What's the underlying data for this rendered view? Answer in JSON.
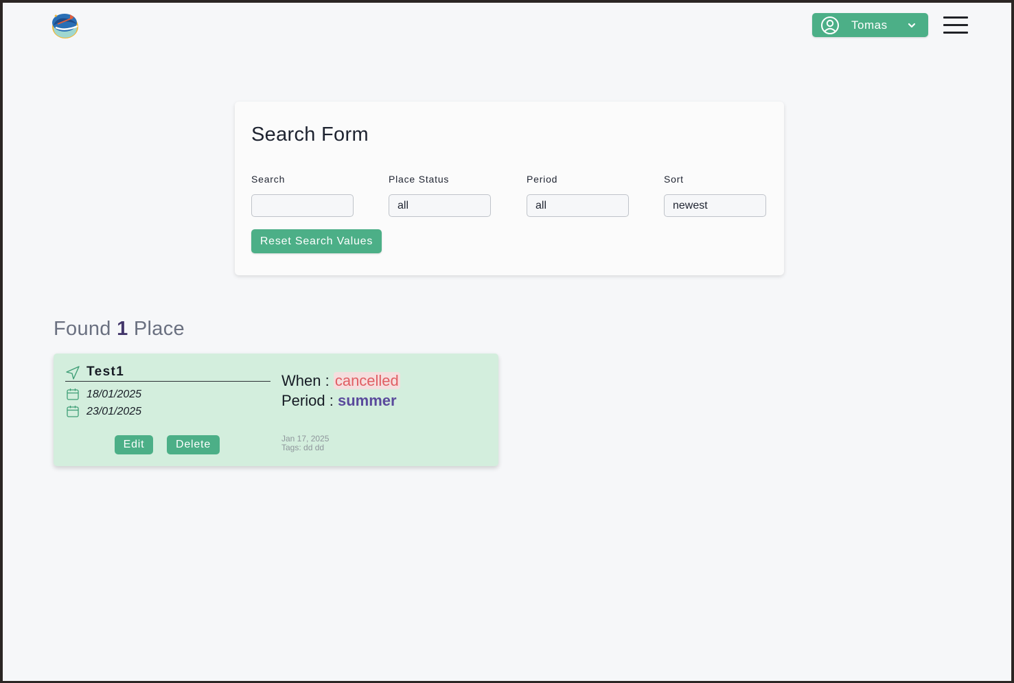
{
  "header": {
    "user_name": "Tomas",
    "icons": {
      "logo": "app-logo",
      "user": "user-circle-icon",
      "dropdown": "chevron-down-icon",
      "menu": "hamburger-menu-icon"
    }
  },
  "search_form": {
    "title": "Search Form",
    "fields": {
      "search": {
        "label": "Search",
        "value": ""
      },
      "place_status": {
        "label": "Place Status",
        "value": "all"
      },
      "period": {
        "label": "Period",
        "value": "all"
      },
      "sort": {
        "label": "Sort",
        "value": "newest"
      }
    },
    "reset_label": "Reset Search Values"
  },
  "results": {
    "prefix": "Found",
    "count": "1",
    "suffix": "Place"
  },
  "place": {
    "name": "Test1",
    "start_date": "18/01/2025",
    "end_date": "23/01/2025",
    "when_label": "When :",
    "status": "cancelled",
    "period_label": "Period :",
    "period": "summer",
    "created": "Jan 17, 2025",
    "tags": "Tags: dd dd",
    "edit_label": "Edit",
    "delete_label": "Delete"
  },
  "colors": {
    "accent": "#4caf87",
    "card_bg": "#d3eedd",
    "status_cancelled": "#e05e63",
    "period": "#5a4a9c",
    "count": "#43376b"
  }
}
